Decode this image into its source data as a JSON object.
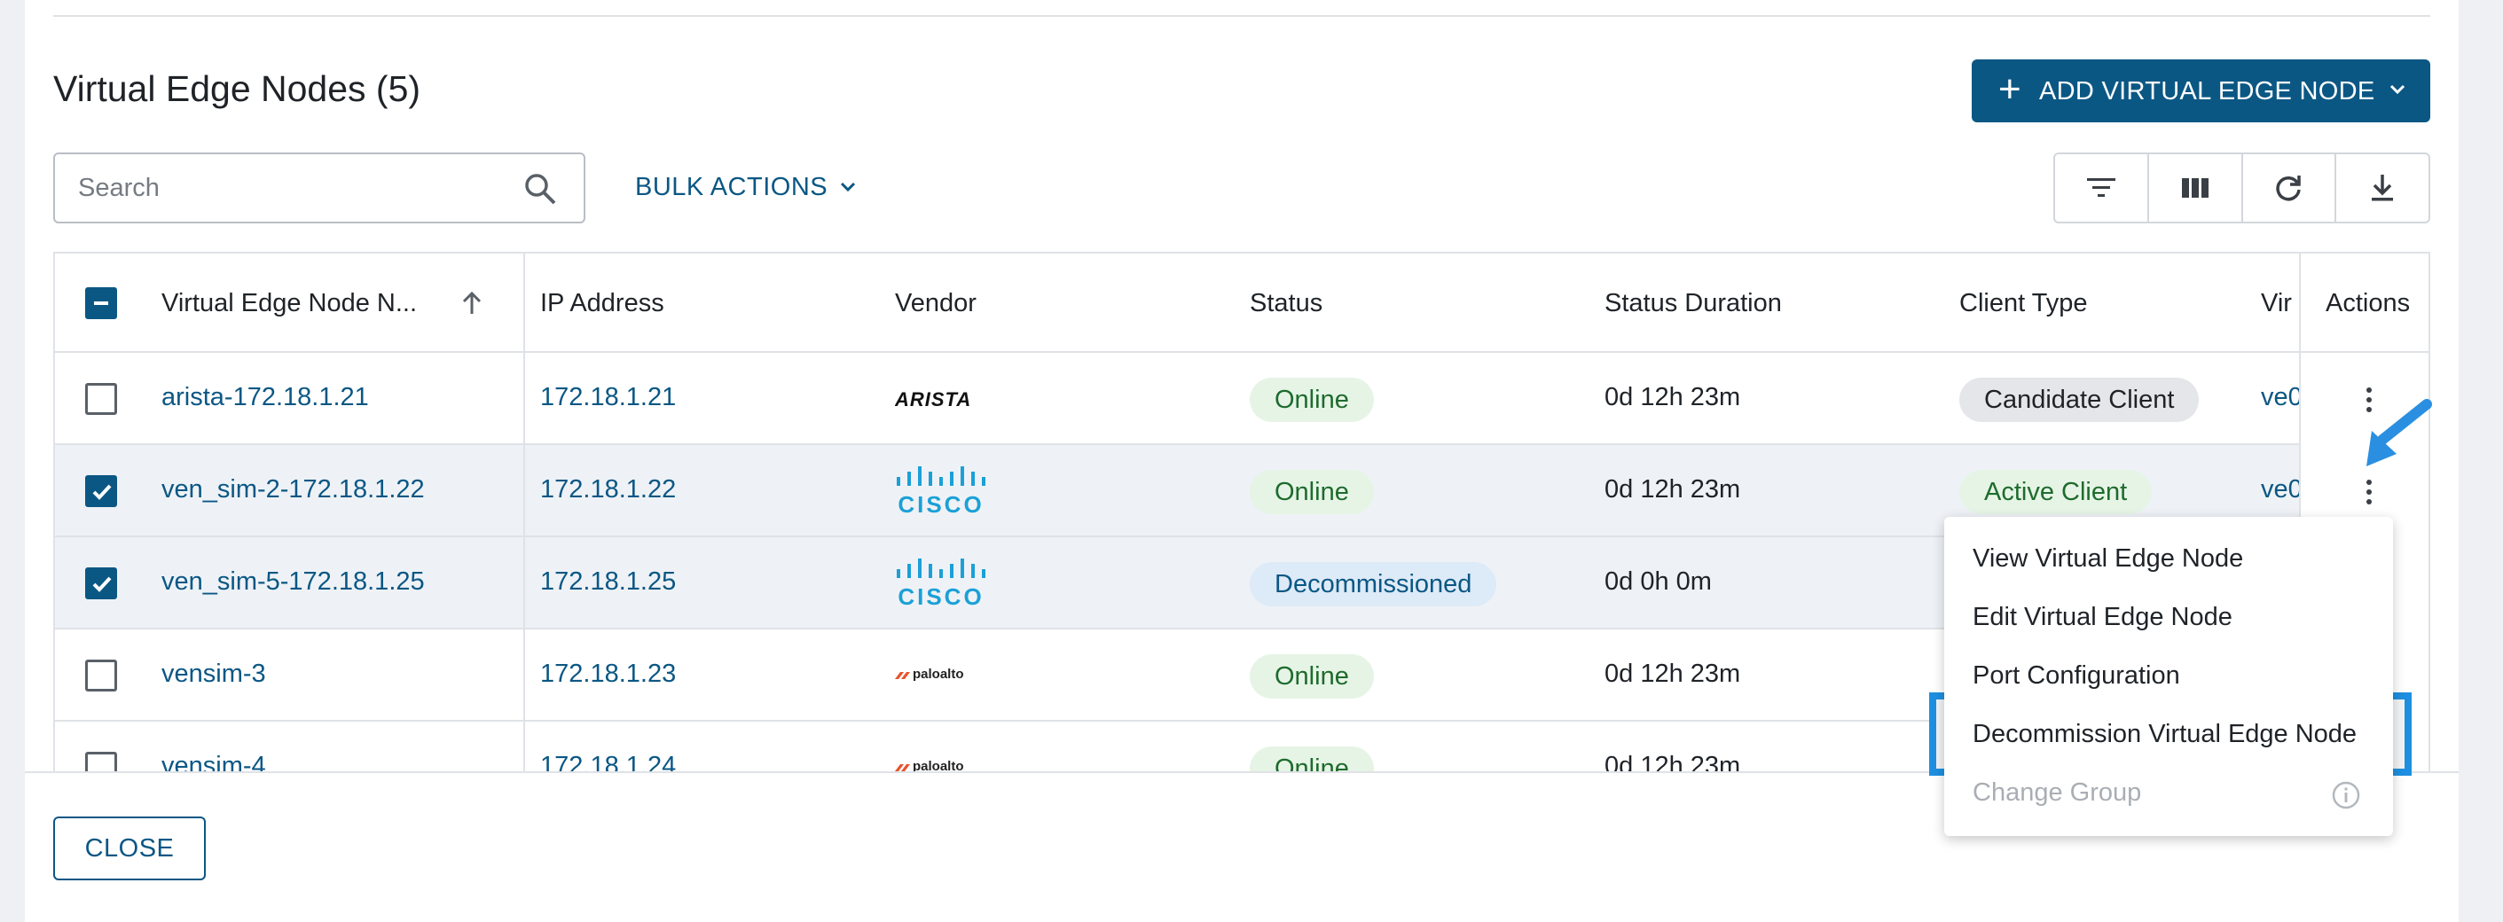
{
  "title": "Virtual Edge Nodes (5)",
  "add_button": "ADD VIRTUAL EDGE NODE",
  "search": {
    "placeholder": "Search"
  },
  "bulk_actions": "BULK ACTIONS",
  "toolbar": [
    "filter-icon",
    "columns-icon",
    "refresh-icon",
    "download-icon"
  ],
  "columns": [
    "Virtual Edge Node N...",
    "IP Address",
    "Vendor",
    "Status",
    "Status Duration",
    "Client Type",
    "Vir",
    "Actions"
  ],
  "rows": [
    {
      "name": "arista-172.18.1.21",
      "ip": "172.18.1.21",
      "vendor": "ARISTA",
      "status": "Online",
      "duration": "0d 12h 23m",
      "client": "Candidate Client",
      "vir": "ve0",
      "checked": false
    },
    {
      "name": "ven_sim-2-172.18.1.22",
      "ip": "172.18.1.22",
      "vendor": "CISCO",
      "status": "Online",
      "duration": "0d 12h 23m",
      "client": "Active Client",
      "vir": "ve0",
      "checked": true
    },
    {
      "name": "ven_sim-5-172.18.1.25",
      "ip": "172.18.1.25",
      "vendor": "CISCO",
      "status": "Decommissioned",
      "duration": "0d 0h 0m",
      "client": "",
      "vir": "",
      "checked": true
    },
    {
      "name": "vensim-3",
      "ip": "172.18.1.23",
      "vendor": "paloalto",
      "status": "Online",
      "duration": "0d 12h 23m",
      "client": "",
      "vir": "",
      "checked": false
    },
    {
      "name": "vensim-4",
      "ip": "172.18.1.24",
      "vendor": "paloalto",
      "status": "Online",
      "duration": "0d 12h 23m",
      "client": "",
      "vir": "",
      "checked": false
    }
  ],
  "menu": [
    {
      "label": "View Virtual Edge Node",
      "enabled": true
    },
    {
      "label": "Edit Virtual Edge Node",
      "enabled": true
    },
    {
      "label": "Port Configuration",
      "enabled": true
    },
    {
      "label": "Decommission Virtual Edge Node",
      "enabled": true
    },
    {
      "label": "Change Group",
      "enabled": false
    }
  ],
  "close_button": "CLOSE",
  "colors": {
    "primary": "#0b5784",
    "online_bg": "#e6f4e6",
    "online_text": "#1e6b2d",
    "decom_bg": "#ddeaf7",
    "highlight": "#1e8fe0",
    "arrow": "#2a8fe0"
  }
}
